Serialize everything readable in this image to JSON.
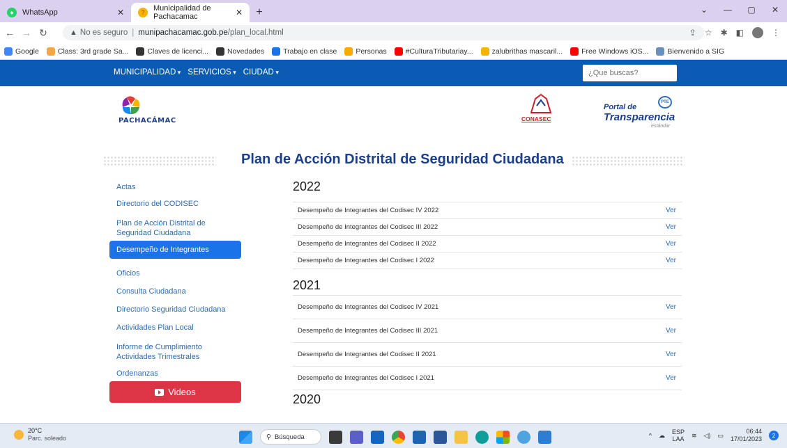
{
  "browser": {
    "tabs": [
      {
        "label": "WhatsApp",
        "icon": "whatsapp-icon",
        "color": "#25d366"
      },
      {
        "label": "Municipalidad de Pachacamac",
        "icon": "pachacamac-favicon",
        "color": "#e53935"
      }
    ],
    "new_tab": "+",
    "address": {
      "warning": "No es seguro",
      "host": "munipachacamac.gob.pe",
      "path": "/plan_local.html"
    },
    "bookmarks": [
      {
        "label": "Google",
        "color": "#4285f4"
      },
      {
        "label": "Class: 3rd grade Sa...",
        "color": "#f4a742"
      },
      {
        "label": "Claves de licenci...",
        "color": "#333333"
      },
      {
        "label": "Novedades",
        "color": "#333333"
      },
      {
        "label": "Trabajo en clase",
        "color": "#1a73e8"
      },
      {
        "label": "Personas",
        "color": "#f9ab00"
      },
      {
        "label": "#CulturaTributariay...",
        "color": "#ff0000"
      },
      {
        "label": "zalubrithas mascaril...",
        "color": "#f4b400"
      },
      {
        "label": "Free Windows iOS...",
        "color": "#ff0000"
      },
      {
        "label": "Bienvenido a SIG",
        "color": "#6c8ebf"
      }
    ]
  },
  "site": {
    "nav": [
      "MUNICIPALIDAD",
      "SERVICIOS",
      "CIUDAD"
    ],
    "search_placeholder": "¿Que buscas?",
    "logo_pachacamac": "PACHACÁMAC",
    "logo_conasec": "CONASEC",
    "logo_pte": {
      "line1": "Portal de",
      "line2": "Transparencia",
      "line3": "estándar",
      "badge": "PTE"
    },
    "page_title": "Plan de Acción Distrital de Seguridad Ciudadana",
    "sidebar": [
      {
        "label": "Actas",
        "active": false
      },
      {
        "label": "Directorio del CODISEC",
        "active": false
      },
      {
        "label": "Plan de Acción Distrital de Seguridad Ciudadana",
        "active": false
      },
      {
        "label": "Desempeño de Integrantes",
        "active": true
      },
      {
        "label": "Oficios",
        "active": false
      },
      {
        "label": "Consulta Ciudadana",
        "active": false
      },
      {
        "label": "Directorio Seguridad Ciudadana",
        "active": false
      },
      {
        "label": "Actividades Plan Local",
        "active": false
      },
      {
        "label": "Informe de Cumplimiento Actividades Trimestrales",
        "active": false
      },
      {
        "label": "Ordenanzas",
        "active": false
      }
    ],
    "videos_button": "Videos",
    "sections": [
      {
        "year": "2022",
        "rows": [
          {
            "label": "Desempeño de Integrantes del Codisec IV 2022",
            "action": "Ver"
          },
          {
            "label": "Desempeño de Integrantes del Codisec III 2022",
            "action": "Ver"
          },
          {
            "label": "Desempeño de Integrantes del Codisec II 2022",
            "action": "Ver"
          },
          {
            "label": "Desempeño de Integrantes del Codisec I 2022",
            "action": "Ver"
          }
        ]
      },
      {
        "year": "2021",
        "rows": [
          {
            "label": "Desempeño de Integrantes del Codisec IV 2021",
            "action": "Ver"
          },
          {
            "label": "Desempeño de Integrantes del Codisec III 2021",
            "action": "Ver"
          },
          {
            "label": "Desempeño de Integrantes del Codisec II 2021",
            "action": "Ver"
          },
          {
            "label": "Desempeño de Integrantes del Codisec I 2021",
            "action": "Ver"
          }
        ]
      },
      {
        "year": "2020",
        "rows": []
      }
    ]
  },
  "taskbar": {
    "weather_temp": "20°C",
    "weather_desc": "Parc. soleado",
    "search": "Búsqueda",
    "lang1": "ESP",
    "lang2": "LAA",
    "time": "06:44",
    "date": "17/01/2023",
    "notifications": "2"
  }
}
